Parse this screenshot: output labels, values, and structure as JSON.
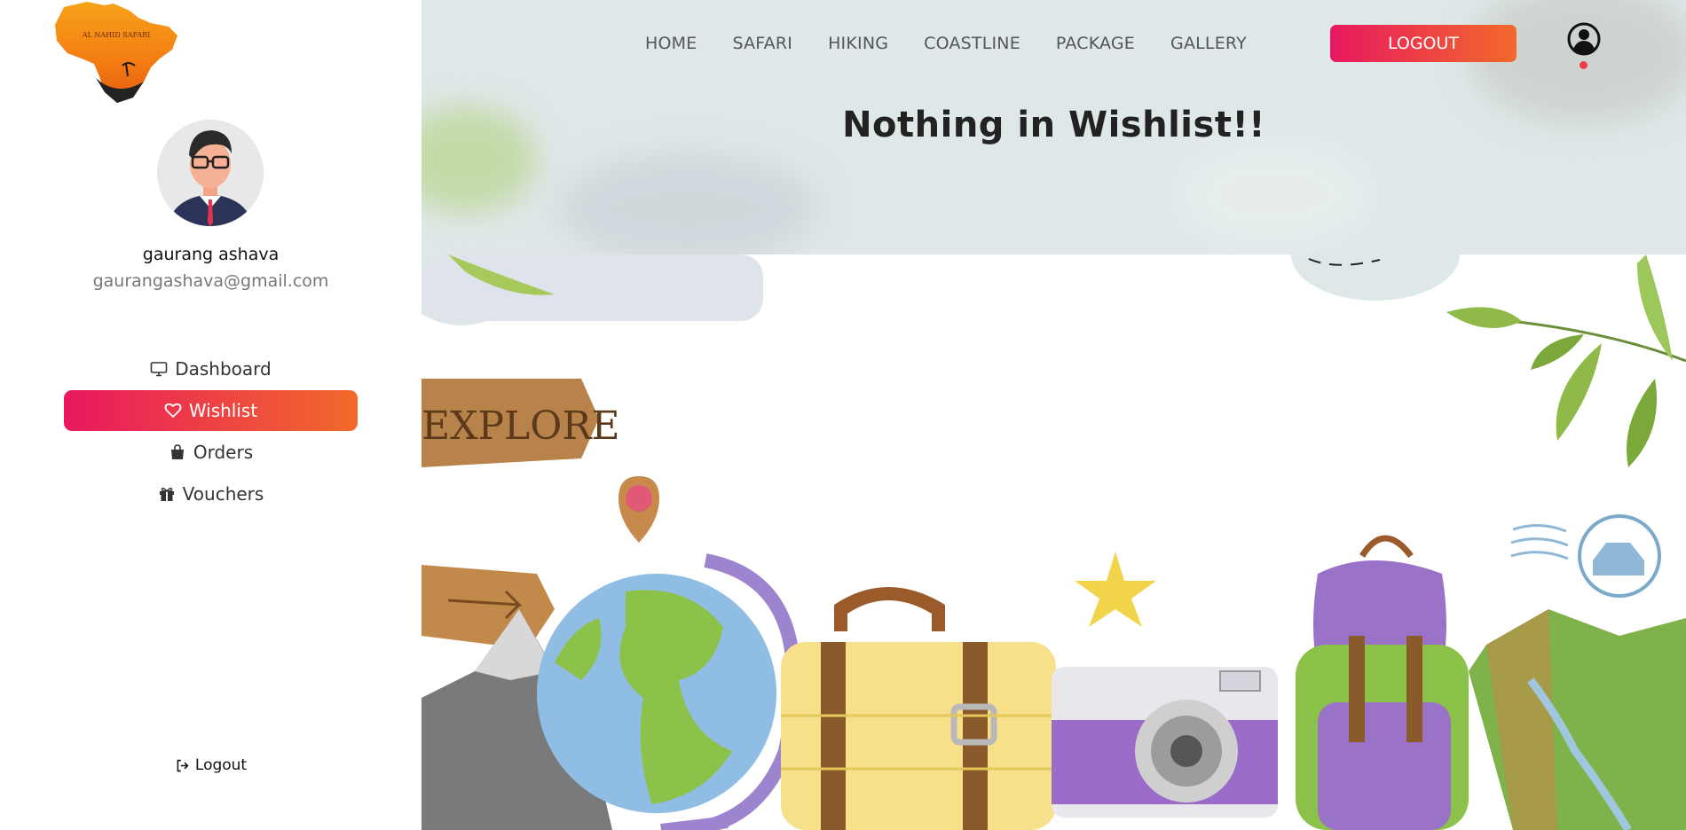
{
  "brand": {
    "logo_text": "AL NAHID SAFARI"
  },
  "profile": {
    "name": "gaurang ashava",
    "email": "gaurangashava@gmail.com"
  },
  "sidebar": {
    "items": [
      {
        "label": "Dashboard",
        "icon": "monitor-icon"
      },
      {
        "label": "Wishlist",
        "icon": "heart-icon",
        "active": true
      },
      {
        "label": "Orders",
        "icon": "shopping-bag-icon"
      },
      {
        "label": "Vouchers",
        "icon": "gift-icon"
      }
    ],
    "logout_label": "Logout"
  },
  "topnav": {
    "links": [
      "HOME",
      "SAFARI",
      "HIKING",
      "COASTLINE",
      "PACKAGE",
      "GALLERY"
    ],
    "logout_label": "LOGOUT"
  },
  "main": {
    "heading": "Nothing in Wishlist!!"
  },
  "illustration": {
    "sign_text": "EXPLORE"
  },
  "colors": {
    "accent_start": "#e8185f",
    "accent_end": "#f26a2a",
    "hero_bg": "#dfe8e9",
    "notification": "#f0394b"
  }
}
